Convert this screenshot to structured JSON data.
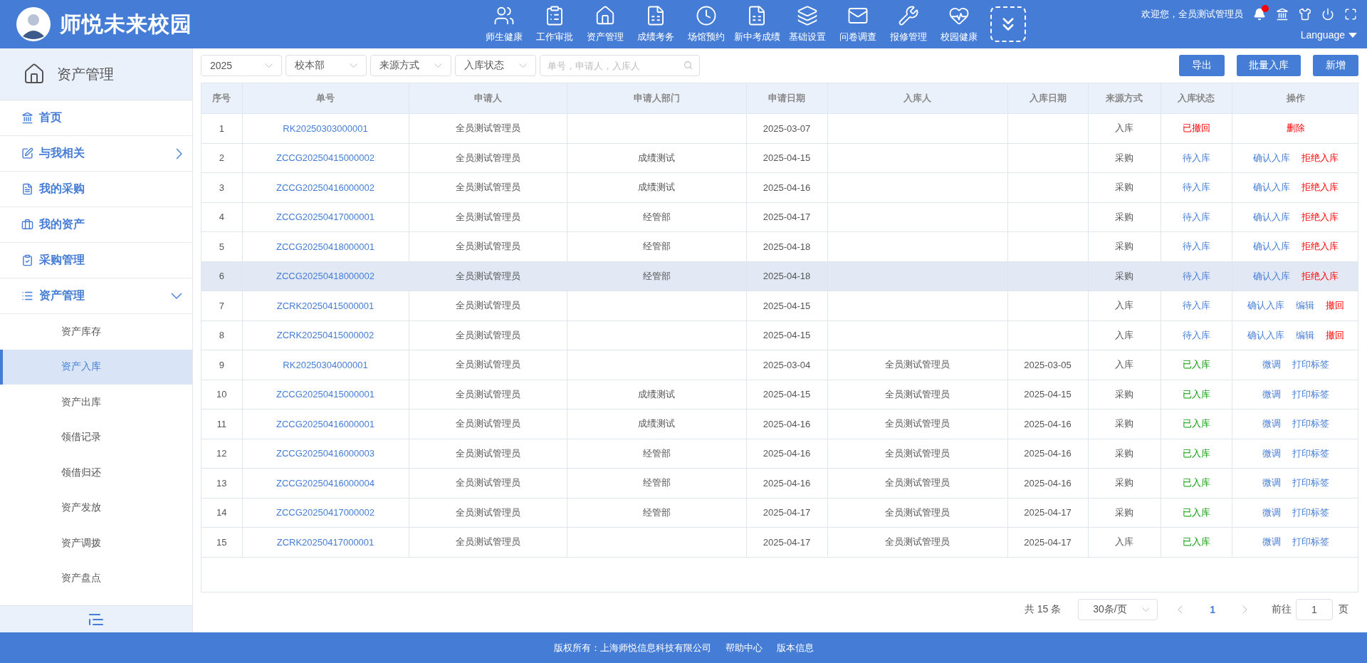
{
  "header": {
    "title": "师悦未来校园",
    "nav": [
      {
        "label": "师生健康"
      },
      {
        "label": "工作审批"
      },
      {
        "label": "资产管理"
      },
      {
        "label": "成绩考务"
      },
      {
        "label": "场馆预约"
      },
      {
        "label": "新中考成绩"
      },
      {
        "label": "基础设置"
      },
      {
        "label": "问卷调查"
      },
      {
        "label": "报修管理"
      },
      {
        "label": "校园健康"
      }
    ],
    "welcome": "欢迎您，全员测试管理员",
    "notification_dot": true,
    "language": "Language"
  },
  "sidebar": {
    "title": "资产管理",
    "items": [
      {
        "label": "首页"
      },
      {
        "label": "与我相关",
        "expanded": false
      },
      {
        "label": "我的采购"
      },
      {
        "label": "我的资产"
      },
      {
        "label": "采购管理"
      },
      {
        "label": "资产管理",
        "expanded": true,
        "children": [
          {
            "label": "资产库存",
            "selected": false
          },
          {
            "label": "资产入库",
            "selected": true
          },
          {
            "label": "资产出库",
            "selected": false
          },
          {
            "label": "领借记录",
            "selected": false
          },
          {
            "label": "领借归还",
            "selected": false
          },
          {
            "label": "资产发放",
            "selected": false
          },
          {
            "label": "资产调拨",
            "selected": false
          },
          {
            "label": "资产盘点",
            "selected": false
          }
        ]
      }
    ]
  },
  "filters": [
    {
      "value": "2025"
    },
    {
      "value": "校本部"
    },
    {
      "value": "来源方式"
    },
    {
      "value": "入库状态"
    }
  ],
  "search": {
    "placeholder": "单号，申请人，入库人"
  },
  "buttons": [
    "导出",
    "批量入库",
    "新增"
  ],
  "table": {
    "columns": [
      "序号",
      "单号",
      "申请人",
      "申请人部门",
      "申请日期",
      "入库人",
      "入库日期",
      "来源方式",
      "入库状态",
      "操作"
    ],
    "rows": [
      {
        "no": "1",
        "id": "RK20250303000001",
        "applicant": "全员测试管理员",
        "dept": "",
        "date": "2025-03-07",
        "receiver": "",
        "in_date": "",
        "source": "入库",
        "status": {
          "text": "已撤回",
          "kind": "revoked"
        },
        "actions": [
          {
            "text": "删除",
            "kind": "danger"
          }
        ],
        "highlighted": false
      },
      {
        "no": "2",
        "id": "ZCCG20250415000002",
        "applicant": "全员测试管理员",
        "dept": "成绩测试",
        "date": "2025-04-15",
        "receiver": "",
        "in_date": "",
        "source": "采购",
        "status": {
          "text": "待入库",
          "kind": "pending"
        },
        "actions": [
          {
            "text": "确认入库",
            "kind": "link"
          },
          {
            "text": "拒绝入库",
            "kind": "danger"
          }
        ],
        "highlighted": false
      },
      {
        "no": "3",
        "id": "ZCCG20250416000002",
        "applicant": "全员测试管理员",
        "dept": "成绩测试",
        "date": "2025-04-16",
        "receiver": "",
        "in_date": "",
        "source": "采购",
        "status": {
          "text": "待入库",
          "kind": "pending"
        },
        "actions": [
          {
            "text": "确认入库",
            "kind": "link"
          },
          {
            "text": "拒绝入库",
            "kind": "danger"
          }
        ],
        "highlighted": false
      },
      {
        "no": "4",
        "id": "ZCCG20250417000001",
        "applicant": "全员测试管理员",
        "dept": "经管部",
        "date": "2025-04-17",
        "receiver": "",
        "in_date": "",
        "source": "采购",
        "status": {
          "text": "待入库",
          "kind": "pending"
        },
        "actions": [
          {
            "text": "确认入库",
            "kind": "link"
          },
          {
            "text": "拒绝入库",
            "kind": "danger"
          }
        ],
        "highlighted": false
      },
      {
        "no": "5",
        "id": "ZCCG20250418000001",
        "applicant": "全员测试管理员",
        "dept": "经管部",
        "date": "2025-04-18",
        "receiver": "",
        "in_date": "",
        "source": "采购",
        "status": {
          "text": "待入库",
          "kind": "pending"
        },
        "actions": [
          {
            "text": "确认入库",
            "kind": "link"
          },
          {
            "text": "拒绝入库",
            "kind": "danger"
          }
        ],
        "highlighted": false
      },
      {
        "no": "6",
        "id": "ZCCG20250418000002",
        "applicant": "全员测试管理员",
        "dept": "经管部",
        "date": "2025-04-18",
        "receiver": "",
        "in_date": "",
        "source": "采购",
        "status": {
          "text": "待入库",
          "kind": "pending"
        },
        "actions": [
          {
            "text": "确认入库",
            "kind": "link"
          },
          {
            "text": "拒绝入库",
            "kind": "danger"
          }
        ],
        "highlighted": true
      },
      {
        "no": "7",
        "id": "ZCRK20250415000001",
        "applicant": "全员测试管理员",
        "dept": "",
        "date": "2025-04-15",
        "receiver": "",
        "in_date": "",
        "source": "入库",
        "status": {
          "text": "待入库",
          "kind": "pending"
        },
        "actions": [
          {
            "text": "确认入库",
            "kind": "link"
          },
          {
            "text": "编辑",
            "kind": "link"
          },
          {
            "text": "撤回",
            "kind": "danger"
          }
        ],
        "highlighted": false
      },
      {
        "no": "8",
        "id": "ZCRK20250415000002",
        "applicant": "全员测试管理员",
        "dept": "",
        "date": "2025-04-15",
        "receiver": "",
        "in_date": "",
        "source": "入库",
        "status": {
          "text": "待入库",
          "kind": "pending"
        },
        "actions": [
          {
            "text": "确认入库",
            "kind": "link"
          },
          {
            "text": "编辑",
            "kind": "link"
          },
          {
            "text": "撤回",
            "kind": "danger"
          }
        ],
        "highlighted": false
      },
      {
        "no": "9",
        "id": "RK20250304000001",
        "applicant": "全员测试管理员",
        "dept": "",
        "date": "2025-03-04",
        "receiver": "全员测试管理员",
        "in_date": "2025-03-05",
        "source": "入库",
        "status": {
          "text": "已入库",
          "kind": "stored"
        },
        "actions": [
          {
            "text": "微调",
            "kind": "link"
          },
          {
            "text": "打印标签",
            "kind": "link"
          }
        ],
        "highlighted": false
      },
      {
        "no": "10",
        "id": "ZCCG20250415000001",
        "applicant": "全员测试管理员",
        "dept": "成绩测试",
        "date": "2025-04-15",
        "receiver": "全员测试管理员",
        "in_date": "2025-04-15",
        "source": "采购",
        "status": {
          "text": "已入库",
          "kind": "stored"
        },
        "actions": [
          {
            "text": "微调",
            "kind": "link"
          },
          {
            "text": "打印标签",
            "kind": "link"
          }
        ],
        "highlighted": false
      },
      {
        "no": "11",
        "id": "ZCCG20250416000001",
        "applicant": "全员测试管理员",
        "dept": "成绩测试",
        "date": "2025-04-16",
        "receiver": "全员测试管理员",
        "in_date": "2025-04-16",
        "source": "采购",
        "status": {
          "text": "已入库",
          "kind": "stored"
        },
        "actions": [
          {
            "text": "微调",
            "kind": "link"
          },
          {
            "text": "打印标签",
            "kind": "link"
          }
        ],
        "highlighted": false
      },
      {
        "no": "12",
        "id": "ZCCG20250416000003",
        "applicant": "全员测试管理员",
        "dept": "经管部",
        "date": "2025-04-16",
        "receiver": "全员测试管理员",
        "in_date": "2025-04-16",
        "source": "采购",
        "status": {
          "text": "已入库",
          "kind": "stored"
        },
        "actions": [
          {
            "text": "微调",
            "kind": "link"
          },
          {
            "text": "打印标签",
            "kind": "link"
          }
        ],
        "highlighted": false
      },
      {
        "no": "13",
        "id": "ZCCG20250416000004",
        "applicant": "全员测试管理员",
        "dept": "经管部",
        "date": "2025-04-16",
        "receiver": "全员测试管理员",
        "in_date": "2025-04-16",
        "source": "采购",
        "status": {
          "text": "已入库",
          "kind": "stored"
        },
        "actions": [
          {
            "text": "微调",
            "kind": "link"
          },
          {
            "text": "打印标签",
            "kind": "link"
          }
        ],
        "highlighted": false
      },
      {
        "no": "14",
        "id": "ZCCG20250417000002",
        "applicant": "全员测试管理员",
        "dept": "经管部",
        "date": "2025-04-17",
        "receiver": "全员测试管理员",
        "in_date": "2025-04-17",
        "source": "采购",
        "status": {
          "text": "已入库",
          "kind": "stored"
        },
        "actions": [
          {
            "text": "微调",
            "kind": "link"
          },
          {
            "text": "打印标签",
            "kind": "link"
          }
        ],
        "highlighted": false
      },
      {
        "no": "15",
        "id": "ZCRK20250417000001",
        "applicant": "全员测试管理员",
        "dept": "",
        "date": "2025-04-17",
        "receiver": "全员测试管理员",
        "in_date": "2025-04-17",
        "source": "入库",
        "status": {
          "text": "已入库",
          "kind": "stored"
        },
        "actions": [
          {
            "text": "微调",
            "kind": "link"
          },
          {
            "text": "打印标签",
            "kind": "link"
          }
        ],
        "highlighted": false
      }
    ]
  },
  "pagination": {
    "total": "共 15 条",
    "page_size": "30条/页",
    "pages": [
      {
        "label": "1",
        "selected": true
      }
    ],
    "goto_label": "前往",
    "goto_value": "1",
    "goto_suffix": "页"
  },
  "footer": [
    "版权所有：上海师悦信息科技有限公司",
    "帮助中心",
    "版本信息"
  ]
}
